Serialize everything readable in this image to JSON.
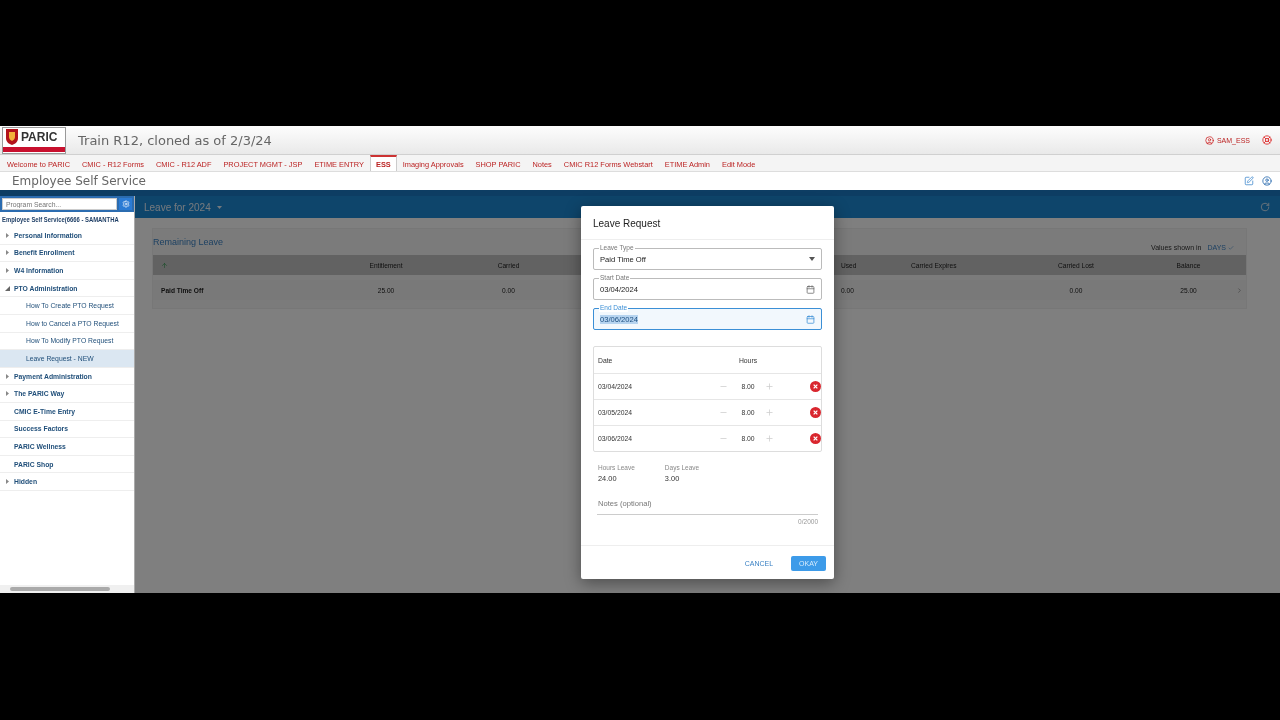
{
  "app": {
    "logo_text": "PARIC",
    "title": "Train R12, cloned as of 2/3/24",
    "user": "SAM_ESS"
  },
  "nav_tabs": [
    {
      "label": "Welcome to PARIC",
      "selected": false
    },
    {
      "label": "CMIC - R12 Forms",
      "selected": false
    },
    {
      "label": "CMIC - R12 ADF",
      "selected": false
    },
    {
      "label": "PROJECT MGMT - JSP",
      "selected": false
    },
    {
      "label": "ETIME ENTRY",
      "selected": false
    },
    {
      "label": "ESS",
      "selected": true
    },
    {
      "label": "Imaging Approvals",
      "selected": false
    },
    {
      "label": "SHOP PARIC",
      "selected": false
    },
    {
      "label": "Notes",
      "selected": false
    },
    {
      "label": "CMIC R12 Forms Webstart",
      "selected": false
    },
    {
      "label": "ETIME Admin",
      "selected": false
    },
    {
      "label": "Edit Mode",
      "selected": false
    }
  ],
  "page_title": "Employee Self Service",
  "sidebar": {
    "search_placeholder": "Program Search...",
    "heading": "Employee Self Service(6666 - SAMANTHA",
    "items": [
      {
        "label": "Personal Information",
        "expandable": true,
        "expanded": false,
        "selected": false
      },
      {
        "label": "Benefit Enrollment",
        "expandable": true,
        "expanded": false,
        "selected": false
      },
      {
        "label": "W4 Information",
        "expandable": true,
        "expanded": false,
        "selected": false
      },
      {
        "label": "PTO Administration",
        "expandable": true,
        "expanded": true,
        "selected": false,
        "children": [
          {
            "label": "How To Create PTO Request",
            "selected": false
          },
          {
            "label": "How to Cancel a PTO Request",
            "selected": false
          },
          {
            "label": "How To Modify PTO Request",
            "selected": false
          },
          {
            "label": "Leave Request - NEW",
            "selected": true
          }
        ]
      },
      {
        "label": "Payment Administration",
        "expandable": true,
        "expanded": false,
        "selected": false
      },
      {
        "label": "The PARIC Way",
        "expandable": true,
        "expanded": false,
        "selected": false
      },
      {
        "label": "CMIC E-Time Entry",
        "expandable": false,
        "expanded": false,
        "selected": false
      },
      {
        "label": "Success Factors",
        "expandable": false,
        "expanded": false,
        "selected": false
      },
      {
        "label": "PARIC Wellness",
        "expandable": false,
        "expanded": false,
        "selected": false
      },
      {
        "label": "PARIC Shop",
        "expandable": false,
        "expanded": false,
        "selected": false
      },
      {
        "label": "Hidden",
        "expandable": true,
        "expanded": false,
        "selected": false
      }
    ]
  },
  "content": {
    "header": "Leave for 2024",
    "section_title": "Remaining Leave",
    "units_label": "Values shown in",
    "units_value": "DAYS",
    "table": {
      "columns": [
        "",
        "Entitlement",
        "Carried",
        "Used",
        "Carried Expires",
        "Carried Lost",
        "Balance"
      ],
      "rows": [
        {
          "cells": [
            "Paid Time Off",
            "25.00",
            "0.00",
            "0.00",
            null,
            "0.00",
            "25.00"
          ]
        }
      ]
    }
  },
  "dialog": {
    "title": "Leave Request",
    "fields": [
      {
        "kind": "select",
        "label": "Leave Type",
        "value": "Paid Time Off",
        "focused": false
      },
      {
        "kind": "date",
        "label": "Start Date",
        "value": "03/04/2024",
        "focused": false
      },
      {
        "kind": "date",
        "label": "End Date",
        "value": "03/06/2024",
        "focused": true
      }
    ],
    "days": {
      "columns": [
        "Date",
        "Hours"
      ],
      "rows": [
        {
          "date": "03/04/2024",
          "hours": "8.00"
        },
        {
          "date": "03/05/2024",
          "hours": "8.00"
        },
        {
          "date": "03/06/2024",
          "hours": "8.00"
        }
      ]
    },
    "totals": [
      {
        "label": "Hours Leave",
        "value": "24.00"
      },
      {
        "label": "Days Leave",
        "value": "3.00"
      }
    ],
    "notes": {
      "placeholder": "Notes (optional)",
      "counter": "0/2000"
    },
    "buttons": [
      {
        "kind": "text",
        "label": "CANCEL"
      },
      {
        "kind": "primary",
        "label": "OKAY"
      }
    ]
  }
}
